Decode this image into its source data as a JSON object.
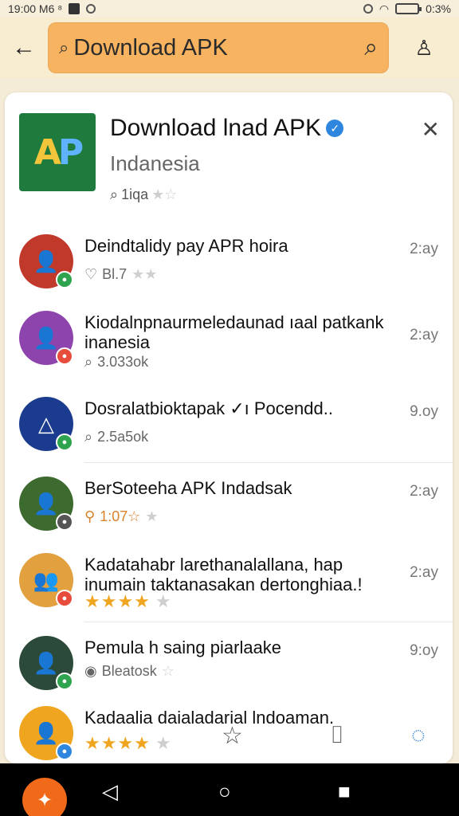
{
  "status_bar": {
    "time": "19:00 M6 ⁸",
    "battery": "0:3%"
  },
  "top_bar": {
    "search_text": "Download APK"
  },
  "app": {
    "name": "Download lnad APK",
    "subtitle": "Indanesia",
    "meta": "1iqa",
    "logo_text_a": "A",
    "logo_text_b": "P"
  },
  "items": [
    {
      "title": "Deindtalidy pay APR hoira",
      "meta": "Bl.7",
      "time": "2:ay",
      "meta_icon": "heart-icon",
      "stars": "★",
      "stars_empty": "★"
    },
    {
      "title": "Kiodalnpnaurmeledaunad ıaal patkank inanesia",
      "meta": "3.033ok",
      "time": "2:ay",
      "meta_icon": "search-icon"
    },
    {
      "title": "Dosralatbioktapak ✓ı Pocendd..",
      "meta": "2.5a5ok",
      "time": "9.oy",
      "meta_icon": "search-icon"
    },
    {
      "title": "BerSoteeha APK Indadsak",
      "meta": "1:07☆",
      "time": "2:ay",
      "meta_icon": "pin-icon",
      "stars_empty": "★"
    },
    {
      "title": "Kadatahabr larethanalallana, hap inumain taktanasakan dertonghiaa.!",
      "meta": "",
      "time": "2:ay",
      "stars": "★★★★",
      "stars_empty": "★"
    },
    {
      "title": "Pemula h saing piarlaake",
      "meta": "Bleatosk",
      "time": "9:oy",
      "meta_icon": "eye-icon",
      "stars_empty": "☆"
    },
    {
      "title": "Kadaalia daialadarial lndoaman.",
      "meta": "",
      "time": "",
      "stars": "★★★★",
      "stars_empty": "★"
    }
  ],
  "colors": {
    "accent": "#f7b35f",
    "background": "#f5ecd8",
    "star": "#f0a521",
    "verified": "#2e86de"
  }
}
